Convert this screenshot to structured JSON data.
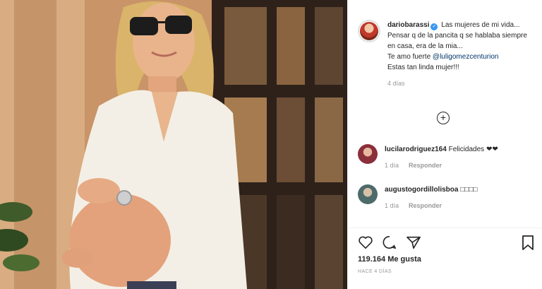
{
  "post": {
    "username": "dariobarassi",
    "caption_text": "Las mujeres de mi vida... Pensar q de la pancita q se hablaba siempre en casa, era de la mia...",
    "caption_line2_prefix": "Te amo fuerte ",
    "caption_mention": "@luligomezcenturion",
    "caption_line3": "Estas tan linda mujer!!!",
    "caption_time": "4 días"
  },
  "load_more_symbol": "+",
  "comments": [
    {
      "username": "lucilarodriguez164",
      "text": "Felicidades ❤❤",
      "time": "1 día",
      "reply_label": "Responder",
      "avatar_color": "#8b2f3a"
    },
    {
      "username": "augustogordillolisboa",
      "text": "□□□□",
      "time": "1 día",
      "reply_label": "Responder",
      "avatar_color": "#4d6b6a"
    }
  ],
  "actions": {
    "likes": "119.164 Me gusta",
    "posted_ago": "HACE 4 DÍAS",
    "icons": [
      "heart-icon",
      "comment-icon",
      "share-icon",
      "bookmark-icon"
    ]
  },
  "colors": {
    "verified": "#3897f0",
    "mention": "#003569",
    "muted": "#999999"
  }
}
